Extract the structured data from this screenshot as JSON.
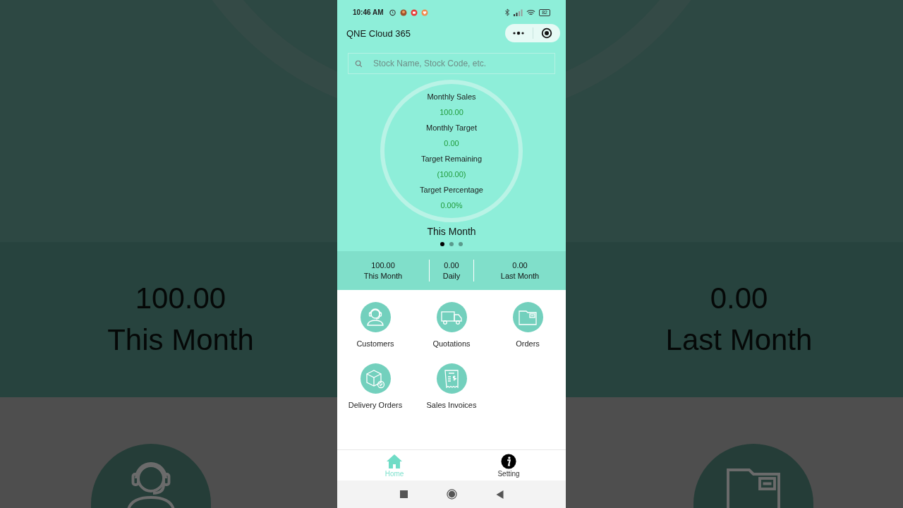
{
  "backdrop": {
    "left": {
      "value": "100.00",
      "label": "This Month"
    },
    "right": {
      "value": "0.00",
      "label": "Last Month"
    }
  },
  "status_bar": {
    "time": "10:46 AM",
    "battery": "82"
  },
  "header": {
    "title": "QNE Cloud 365"
  },
  "search": {
    "placeholder": "Stock Name, Stock Code, etc."
  },
  "summary": [
    {
      "label": "Monthly Sales",
      "value": "100.00"
    },
    {
      "label": "Monthly Target",
      "value": "0.00"
    },
    {
      "label": "Target Remaining",
      "value": "(100.00)"
    },
    {
      "label": "Target Percentage",
      "value": "0.00%"
    }
  ],
  "carousel": {
    "title": "This Month",
    "pages": [
      {
        "selected": true
      },
      {
        "selected": false
      },
      {
        "selected": false
      }
    ]
  },
  "stats": [
    {
      "value": "100.00",
      "label": "This Month"
    },
    {
      "value": "0.00",
      "label": "Daily"
    },
    {
      "value": "0.00",
      "label": "Last Month"
    }
  ],
  "modules": [
    {
      "label": "Customers"
    },
    {
      "label": "Quotations"
    },
    {
      "label": "Orders"
    },
    {
      "label": "Delivery Orders"
    },
    {
      "label": "Sales Invoices"
    }
  ],
  "bottom_nav": [
    {
      "label": "Home",
      "selected": true
    },
    {
      "label": "Setting",
      "selected": false
    }
  ]
}
